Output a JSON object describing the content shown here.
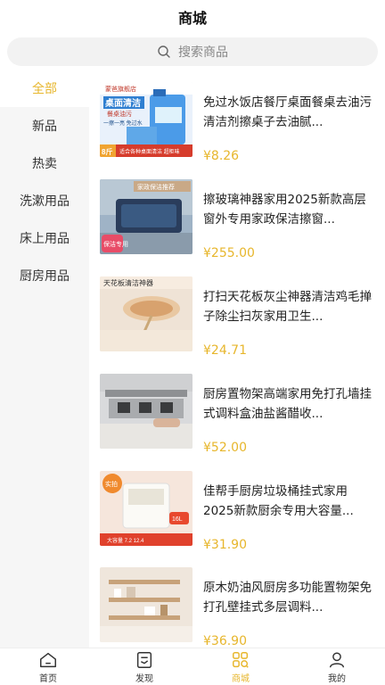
{
  "header": {
    "title": "商城"
  },
  "search": {
    "placeholder": "搜索商品",
    "icon": "search-icon"
  },
  "sidebar": {
    "active_color": "#e7b62c",
    "items": [
      {
        "label": "全部",
        "active": true
      },
      {
        "label": "新品"
      },
      {
        "label": "热卖"
      },
      {
        "label": "洗漱用品"
      },
      {
        "label": "床上用品"
      },
      {
        "label": "厨房用品"
      }
    ]
  },
  "products": [
    {
      "title": "免过水饭店餐厅桌面餐桌去油污清洁剂擦桌子去油腻...",
      "price": "¥8.26",
      "image_text": {
        "store": "蒙爸旗舰店",
        "headline": "桌面清洁",
        "sub": "餐桌油污",
        "note": "一擦一亮 免过水",
        "weight": "8斤",
        "bottom": "适合各种桌面清洁 超柜味"
      }
    },
    {
      "title": "擦玻璃神器家用2025新款高层窗外专用家政保洁擦窗...",
      "price": "¥255.00",
      "image_text": {
        "banner": "家政保洁推荐",
        "badge": "保洁专用"
      }
    },
    {
      "title": "打扫天花板灰尘神器清洁鸡毛掸子除尘扫灰家用卫生...",
      "price": "¥24.71",
      "image_text": {
        "banner": "天花板清洁神器"
      }
    },
    {
      "title": "厨房置物架高端家用免打孔墙挂式调料盒油盐酱醋收...",
      "price": "¥52.00"
    },
    {
      "title": "佳帮手厨房垃圾桶挂式家用2025新款厨余专用大容量...",
      "price": "¥31.90",
      "image_text": {
        "corner": "实拍",
        "size": "16L",
        "bottom": "大容量 7.2 12.4"
      }
    },
    {
      "title": "原木奶油风厨房多功能置物架免打孔壁挂式多层调料...",
      "price": "¥36.90"
    }
  ],
  "tabbar": {
    "items": [
      {
        "label": "首页",
        "icon": "home-icon"
      },
      {
        "label": "发现",
        "icon": "discover-icon"
      },
      {
        "label": "商城",
        "icon": "mall-icon",
        "active": true
      },
      {
        "label": "我的",
        "icon": "profile-icon"
      }
    ]
  }
}
